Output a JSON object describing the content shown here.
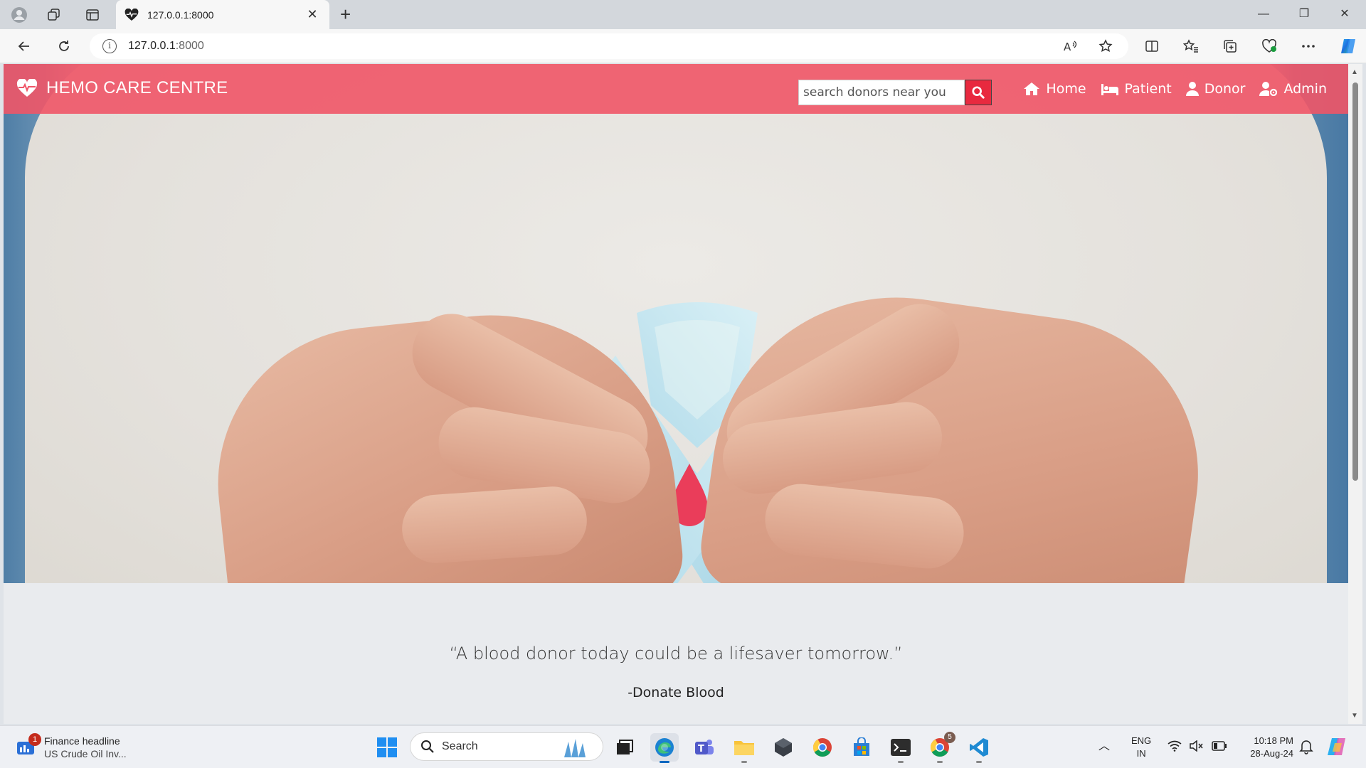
{
  "browser": {
    "tab_title": "127.0.0.1:8000",
    "url_host": "127.0.0.1",
    "url_port": ":8000"
  },
  "site": {
    "brand": "HEMO CARE CENTRE",
    "search": {
      "placeholder": "search donors near you"
    },
    "nav": [
      {
        "label": "Home",
        "icon": "home-icon"
      },
      {
        "label": "Patient",
        "icon": "bed-icon"
      },
      {
        "label": "Donor",
        "icon": "user-icon"
      },
      {
        "label": "Admin",
        "icon": "user-cog-icon"
      }
    ],
    "quote": "“A blood donor today could be a lifesaver tomorrow.”",
    "quote_by": "-Donate Blood",
    "colors": {
      "navbar": "#f05567",
      "search_button": "#e8293f",
      "drop": "#ea3d5a",
      "ribbon": "#bfe3ee"
    }
  },
  "taskbar": {
    "news_badge": "1",
    "news_title": "Finance headline",
    "news_text": "US Crude Oil Inv...",
    "search_label": "Search",
    "lang_1": "ENG",
    "lang_2": "IN",
    "time": "10:18 PM",
    "date": "28-Aug-24",
    "chrome_badge": "5"
  }
}
